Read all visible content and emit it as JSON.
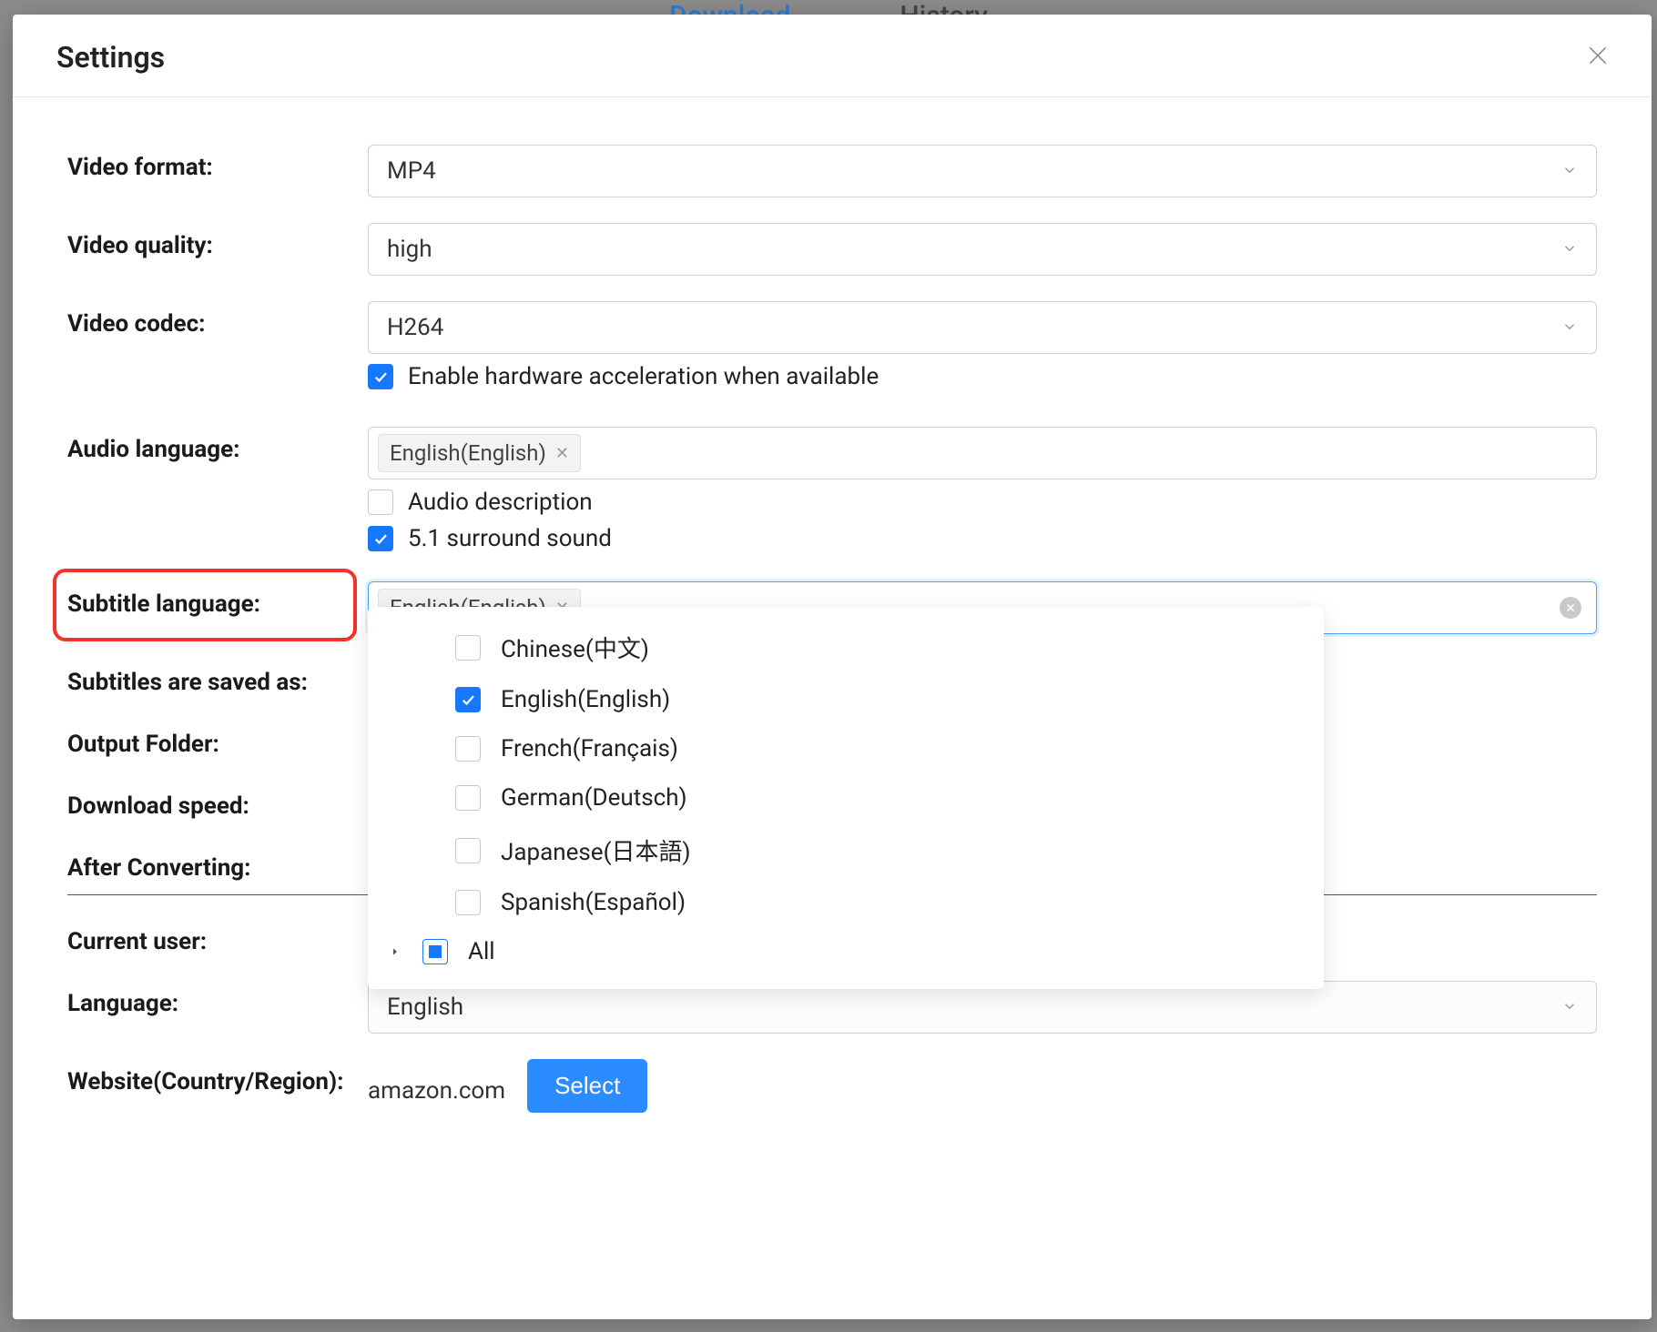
{
  "backTabs": {
    "download": "Download",
    "history": "History"
  },
  "modal": {
    "title": "Settings",
    "fields": {
      "video_format": {
        "label": "Video format:",
        "value": "MP4"
      },
      "video_quality": {
        "label": "Video quality:",
        "value": "high"
      },
      "video_codec": {
        "label": "Video codec:",
        "value": "H264",
        "hw_accel_label": "Enable hardware acceleration when available",
        "hw_accel_checked": true
      },
      "audio_language": {
        "label": "Audio language:",
        "tags": [
          "English(English)"
        ],
        "audio_desc_label": "Audio description",
        "audio_desc_checked": false,
        "surround_label": "5.1 surround sound",
        "surround_checked": true
      },
      "subtitle_language": {
        "label": "Subtitle language:",
        "tags": [
          "English(English)"
        ],
        "options": [
          {
            "label": "Chinese(中文)",
            "checked": false
          },
          {
            "label": "English(English)",
            "checked": true
          },
          {
            "label": "French(Français)",
            "checked": false
          },
          {
            "label": "German(Deutsch)",
            "checked": false
          },
          {
            "label": "Japanese(日本語)",
            "checked": false
          },
          {
            "label": "Spanish(Español)",
            "checked": false
          }
        ],
        "all_label": "All"
      },
      "subtitles_saved_as": {
        "label": "Subtitles are saved as:"
      },
      "output_folder": {
        "label": "Output Folder:"
      },
      "download_speed": {
        "label": "Download speed:"
      },
      "after_converting": {
        "label": "After Converting:"
      },
      "current_user": {
        "label": "Current user:"
      },
      "language": {
        "label": "Language:",
        "value": "English"
      },
      "website": {
        "label": "Website(Country/Region):",
        "value": "amazon.com",
        "select_btn": "Select"
      }
    }
  }
}
